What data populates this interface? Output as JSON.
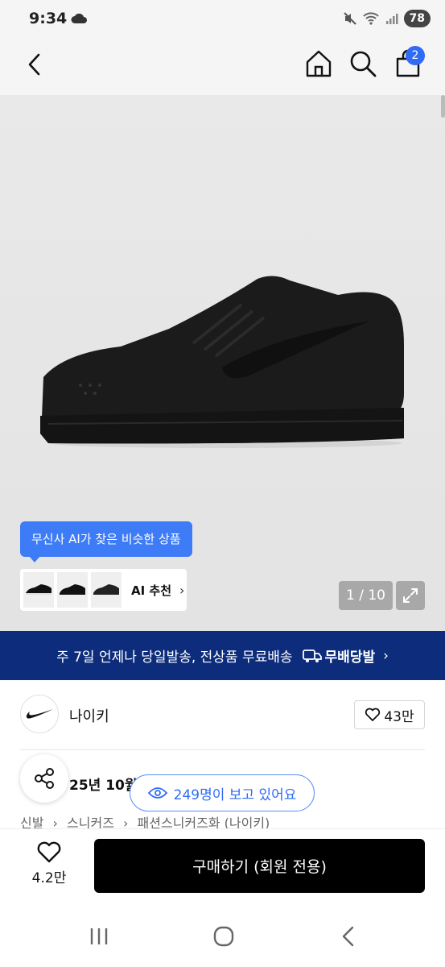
{
  "status_bar": {
    "time": "9:34",
    "battery": "78"
  },
  "header": {
    "cart_badge": "2",
    "icons": [
      "back-arrow-icon",
      "home-icon",
      "search-icon",
      "cart-bag-icon"
    ]
  },
  "gallery": {
    "ai_tooltip": "무신사 AI가 찾은 비슷한 상품",
    "ai_label": "AI 추천",
    "ai_chevron": "›",
    "page_counter": "1 / 10"
  },
  "shipping_banner": {
    "text": "주 7일 언제나 당일발송, 전상품 무료배송",
    "badge": "무배당발",
    "chevron": "›"
  },
  "brand": {
    "name": "나이키",
    "like_count": "43만"
  },
  "product": {
    "release_text": "25년 10월",
    "viewers": "249명이 보고 있어요",
    "breadcrumb": [
      "신발",
      "›",
      "스니커즈",
      "›",
      "패션스니커즈화 (나이키)"
    ]
  },
  "bottom_bar": {
    "wish_count": "4.2만",
    "buy_label": "구매하기 (회원 전용)"
  },
  "colors": {
    "accent_blue": "#2f6bf5",
    "banner_navy": "#0d2d7c",
    "buy_black": "#000000"
  }
}
